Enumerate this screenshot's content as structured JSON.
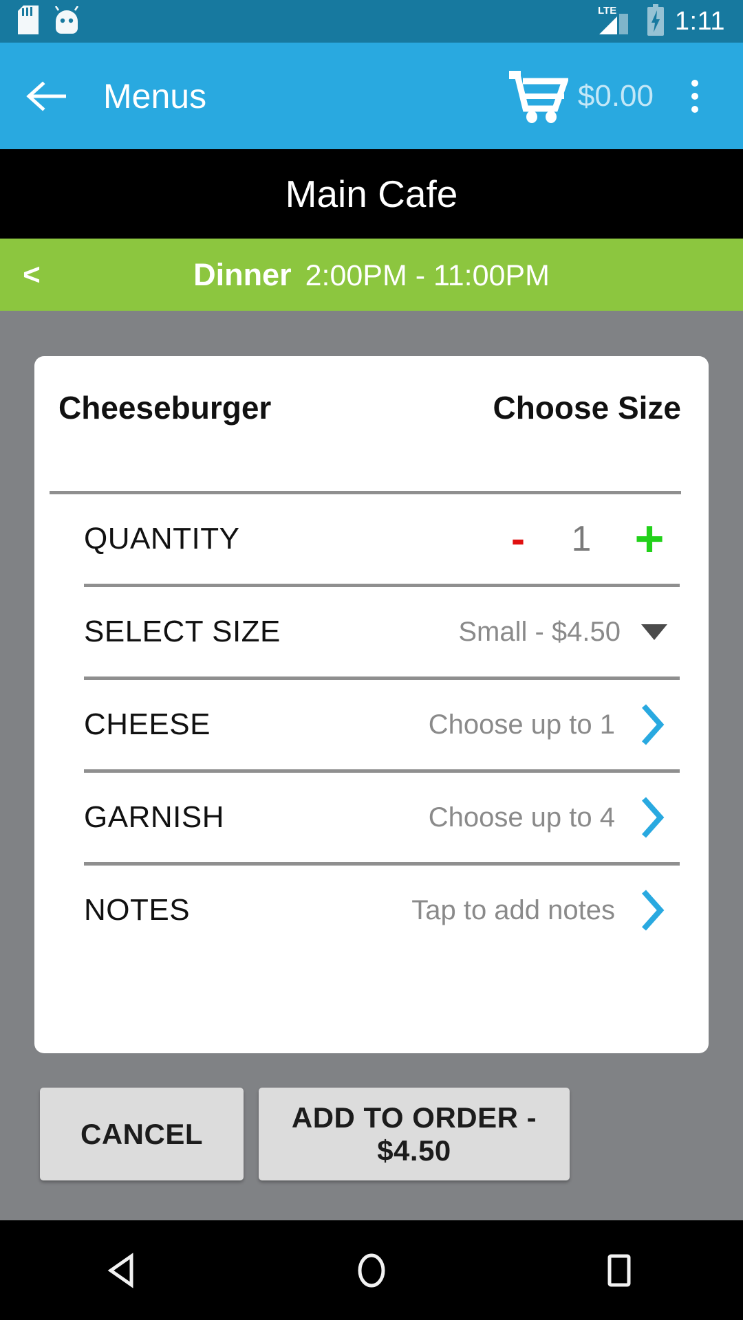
{
  "status_bar": {
    "time": "1:11",
    "network": "LTE",
    "icons": [
      "sd-card-icon",
      "android-head-icon",
      "lte-signal-icon",
      "battery-charging-icon"
    ]
  },
  "app_bar": {
    "back_icon": "arrow-left-icon",
    "title": "Menus",
    "cart_icon": "shopping-cart-icon",
    "cart_total": "$0.00",
    "overflow_icon": "overflow-menu-icon"
  },
  "venue_bar": {
    "name": "Main Cafe"
  },
  "meal_bar": {
    "prev_icon": "chevron-left-icon",
    "name": "Dinner",
    "hours": "2:00PM - 11:00PM"
  },
  "dialog": {
    "item_name": "Cheeseburger",
    "prompt": "Choose Size",
    "quantity": {
      "label": "QUANTITY",
      "minus": "-",
      "value": "1",
      "plus": "+"
    },
    "rows": [
      {
        "label": "SELECT SIZE",
        "value": "Small - $4.50",
        "control": "dropdown"
      },
      {
        "label": "CHEESE",
        "value": "Choose up to 1",
        "control": "chevron"
      },
      {
        "label": "GARNISH",
        "value": "Choose up to 4",
        "control": "chevron"
      },
      {
        "label": "NOTES",
        "value": "Tap to add notes",
        "control": "chevron"
      }
    ]
  },
  "actions": {
    "cancel": "CANCEL",
    "add_to_order": "ADD TO ORDER - $4.50"
  },
  "nav_bar": {
    "back": "back-triangle-icon",
    "home": "home-circle-icon",
    "recents": "recents-square-icon"
  },
  "colors": {
    "status_bar": "#17799f",
    "app_bar": "#29a9e0",
    "venue_bar": "#000000",
    "meal_bar": "#8cc63f",
    "scrim": "#808285",
    "card": "#ffffff",
    "accent_chevron": "#29a9e0",
    "minus": "#e01010",
    "plus": "#22d11a",
    "button": "#dcdcdc"
  }
}
